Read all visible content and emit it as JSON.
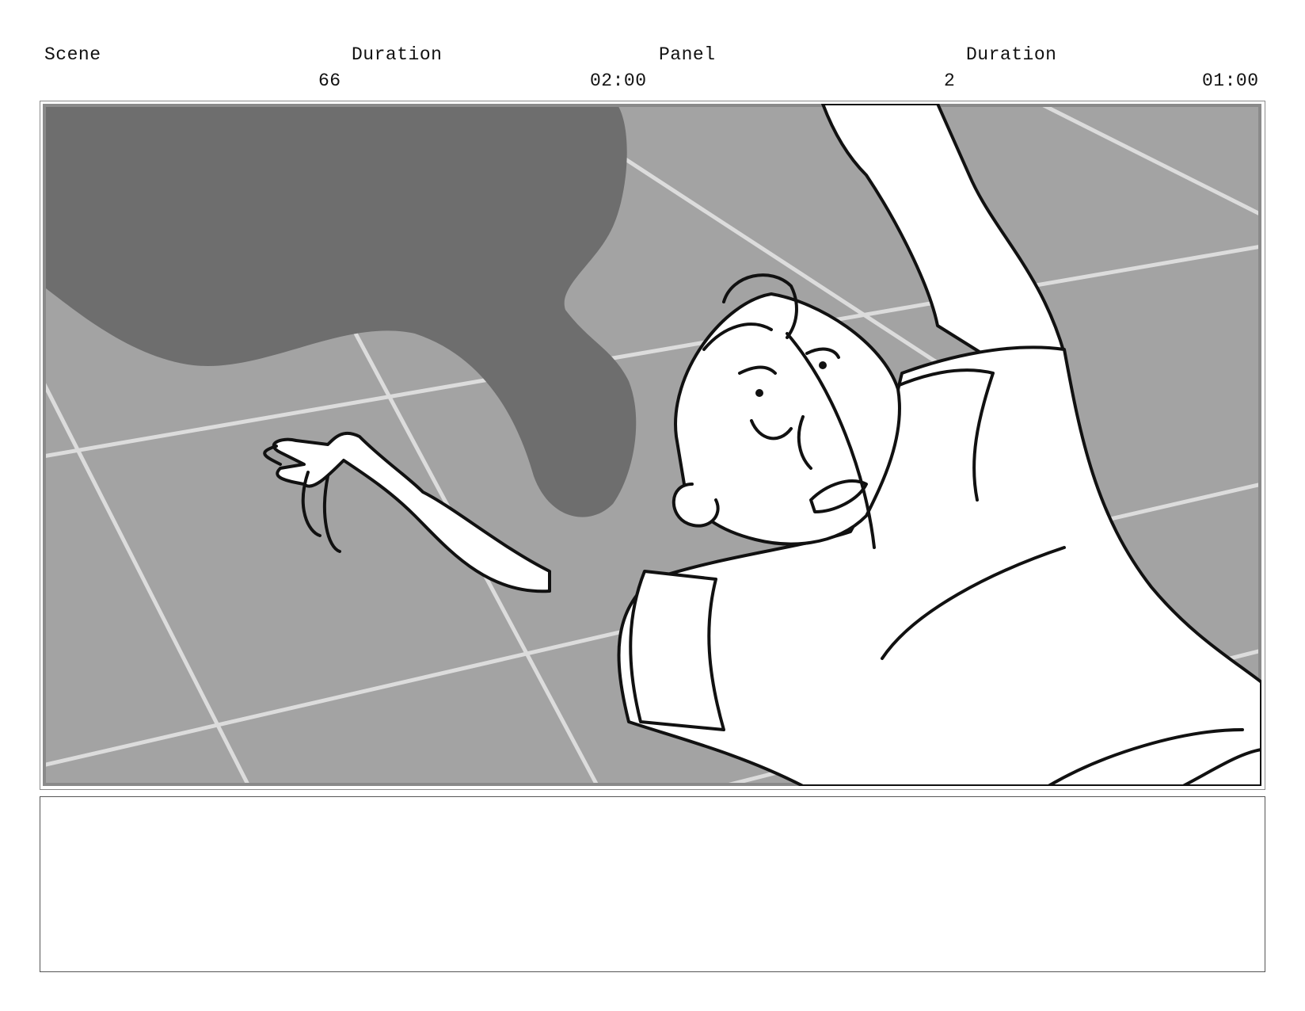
{
  "header": {
    "scene_label": "Scene",
    "scene_duration_label": "Duration",
    "panel_label": "Panel",
    "panel_duration_label": "Duration",
    "scene_value": "66",
    "scene_duration_value": "02:00",
    "panel_value": "2",
    "panel_duration_value": "01:00"
  },
  "panel_image": {
    "description_icon": "storyboard-sketch-character-falling-on-tiled-floor",
    "colors": {
      "floor": "#a3a3a3",
      "shadow": "#6e6e6e",
      "tile_lines": "#dcdcdc",
      "ink": "#111111",
      "figure": "#ffffff"
    }
  },
  "notes": {
    "text": ""
  }
}
